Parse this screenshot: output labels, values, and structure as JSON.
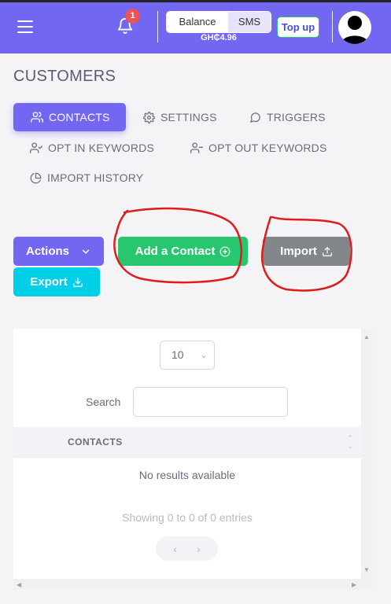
{
  "topbar": {
    "notification_count": "1",
    "balance_label": "Balance",
    "sms_label": "SMS",
    "balance_amount": "GH₵4.96",
    "topup_label": "Top up"
  },
  "page": {
    "title": "CUSTOMERS"
  },
  "nav": {
    "contacts": "CONTACTS",
    "settings": "SETTINGS",
    "triggers": "TRIGGERS",
    "opt_in": "OPT IN KEYWORDS",
    "opt_out": "OPT OUT KEYWORDS",
    "import_history": "IMPORT HISTORY"
  },
  "actions": {
    "actions_label": "Actions",
    "add_contact_label": "Add a Contact",
    "import_label": "Import",
    "export_label": "Export"
  },
  "table": {
    "page_size": "10",
    "search_label": "Search",
    "search_value": "",
    "column_header": "CONTACTS",
    "empty_message": "No results available",
    "showing_text": "Showing 0 to 0 of 0 entries",
    "prev": "‹",
    "next": "›"
  },
  "colors": {
    "primary": "#7366f0",
    "success": "#28c76f",
    "secondary": "#82868b",
    "info": "#00cfe8",
    "danger": "#ea5455",
    "annotation": "#e01b1b"
  }
}
